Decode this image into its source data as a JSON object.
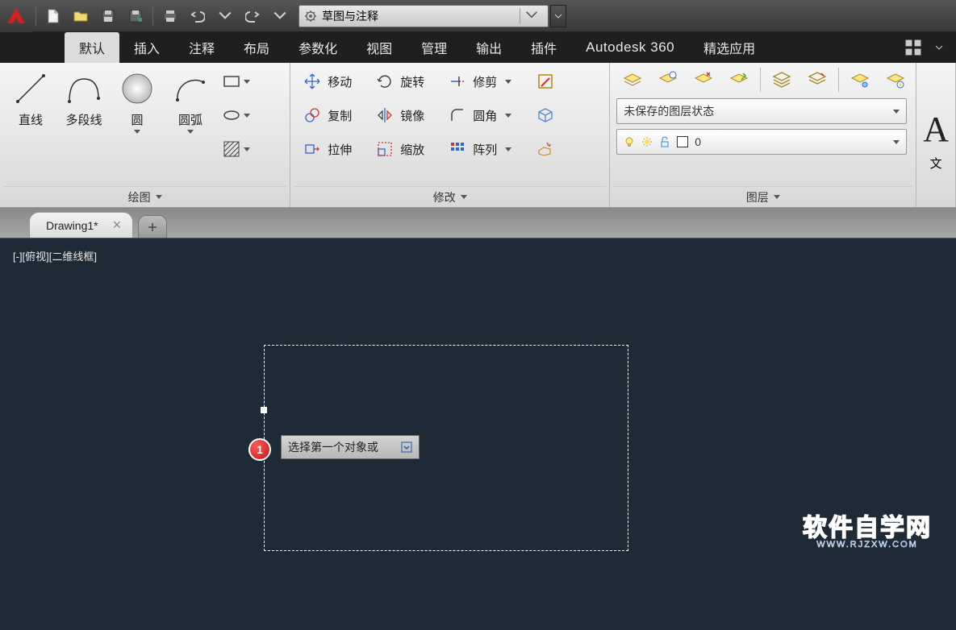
{
  "qat": {
    "workspace_label": "草图与注释"
  },
  "menu": {
    "tabs": [
      "默认",
      "插入",
      "注释",
      "布局",
      "参数化",
      "视图",
      "管理",
      "输出",
      "插件"
    ],
    "brand": "Autodesk 360",
    "featured": "精选应用"
  },
  "ribbon": {
    "draw": {
      "title": "绘图",
      "line": "直线",
      "polyline": "多段线",
      "circle": "圆",
      "arc": "圆弧"
    },
    "modify": {
      "title": "修改",
      "move": "移动",
      "rotate": "旋转",
      "trim": "修剪",
      "copy": "复制",
      "mirror": "镜像",
      "fillet": "圆角",
      "stretch": "拉伸",
      "scale": "缩放",
      "array": "阵列"
    },
    "layers": {
      "title": "图层",
      "state_label": "未保存的图层状态",
      "current": "0"
    },
    "text": {
      "label": "文"
    }
  },
  "file": {
    "tab_name": "Drawing1*"
  },
  "canvas": {
    "viewport_label": "[-][俯视][二维线框]",
    "prompt": "选择第一个对象或",
    "badge": "1",
    "watermark_main": "软件自学网",
    "watermark_sub": "WWW.RJZXW.COM"
  }
}
